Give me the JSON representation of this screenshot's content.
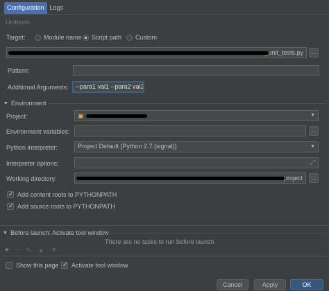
{
  "tabs": [
    "Configuration",
    "Logs"
  ],
  "group_unittests": "Unittests",
  "target": {
    "label": "Target:",
    "options": [
      "Module name",
      "Script path",
      "Custom"
    ],
    "selected": "Script path"
  },
  "script_path": {
    "value_suffix": "_unit_tests.py"
  },
  "pattern": {
    "label": "Pattern:",
    "value": ""
  },
  "additional_arguments": {
    "label": "Additional Arguments:",
    "value": "--para1 val1 --para2 val2"
  },
  "environment": {
    "title": "Environment",
    "project_label": "Project:",
    "env_vars_label": "Environment variables:",
    "interpreter_label": "Python interpreter:",
    "interpreter_value": "Project Default (Python 2.7 (signal))",
    "interpreter_options_label": "Interpreter options:",
    "working_dir_label": "Working directory:",
    "working_dir_suffix": "project",
    "add_content_roots": "Add content roots to PYTHONPATH",
    "add_source_roots": "Add source roots to PYTHONPATH",
    "add_content_checked": true,
    "add_source_checked": true
  },
  "before_launch": {
    "title": "Before launch: Activate tool window",
    "empty_text": "There are no tasks to run before launch",
    "tools": [
      "+",
      "−",
      "✎",
      "▲",
      "▼"
    ]
  },
  "bottom": {
    "show_page": "Show this page",
    "activate_tool": "Activate tool window",
    "show_page_checked": false,
    "activate_tool_checked": true
  },
  "buttons": {
    "cancel": "Cancel",
    "apply": "Apply",
    "ok": "OK"
  },
  "browse_label": "...",
  "colors": {
    "accent": "#4b6eaf",
    "primary_button": "#365880",
    "focus": "#3d6185"
  }
}
